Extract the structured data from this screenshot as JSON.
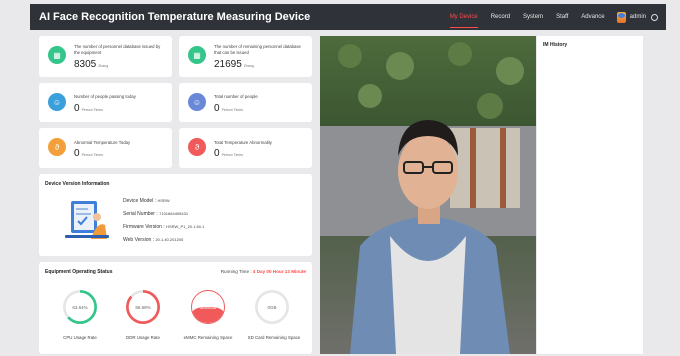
{
  "header": {
    "title": "AI Face Recognition Temperature Measuring Device",
    "nav": [
      "My Device",
      "Record",
      "System",
      "Staff",
      "Advance"
    ],
    "active_index": 0,
    "user": "admin"
  },
  "stats": [
    {
      "label": "The number of personnel database issued by the equipment",
      "value": "8305",
      "unit": "Zhang",
      "icon": "database-icon",
      "color": "#34c58a"
    },
    {
      "label": "The number of remaining personnel database that can be issued",
      "value": "21695",
      "unit": "Zhang",
      "icon": "database-icon",
      "color": "#34c58a"
    },
    {
      "label": "Number of people passing today",
      "value": "0",
      "unit": "Person Times",
      "icon": "users-icon",
      "color": "#3aa0dc"
    },
    {
      "label": "Total number of people",
      "value": "0",
      "unit": "Person Times",
      "icon": "users-icon",
      "color": "#6a88d8"
    },
    {
      "label": "Abnormal Temperature Today",
      "value": "0",
      "unit": "Person Times",
      "icon": "thermometer-icon",
      "color": "#f4a03a"
    },
    {
      "label": "Total Temperature Abnormality",
      "value": "0",
      "unit": "Person Times",
      "icon": "thermometer-icon",
      "color": "#f05a5a"
    }
  ],
  "device": {
    "title": "Device Version Information",
    "model_label": "Device Model :",
    "model": "HSRW",
    "serial_label": "Serial Number :",
    "serial": "7101664495431",
    "firmware_label": "Firmware Version :",
    "firmware": "HSRW_P1_20.1.60.1",
    "web_label": "Web Version :",
    "web": "20.1.40.201205"
  },
  "status": {
    "title": "Equipment Operating Status",
    "running_label": "Running Time :",
    "running_value": "4 Day 00 Hour 13 Minute",
    "gauges": [
      {
        "label": "CPU Usage Rate",
        "value": "63.64%",
        "fraction": 0.6364,
        "color": "#34c58a",
        "kind": "ring"
      },
      {
        "label": "DDR Usage Rate",
        "value": "86.68%",
        "fraction": 0.8668,
        "color": "#f05a5a",
        "kind": "ring"
      },
      {
        "label": "eMMC Remaining Space",
        "value": "1645GB",
        "fraction": 0.35,
        "color": "#f05a5a",
        "kind": "wave"
      },
      {
        "label": "SD Card Remaining Space",
        "value": "0GB",
        "fraction": 0.0,
        "color": "#34c58a",
        "kind": "ring"
      }
    ]
  },
  "history": {
    "title": "IM History"
  }
}
